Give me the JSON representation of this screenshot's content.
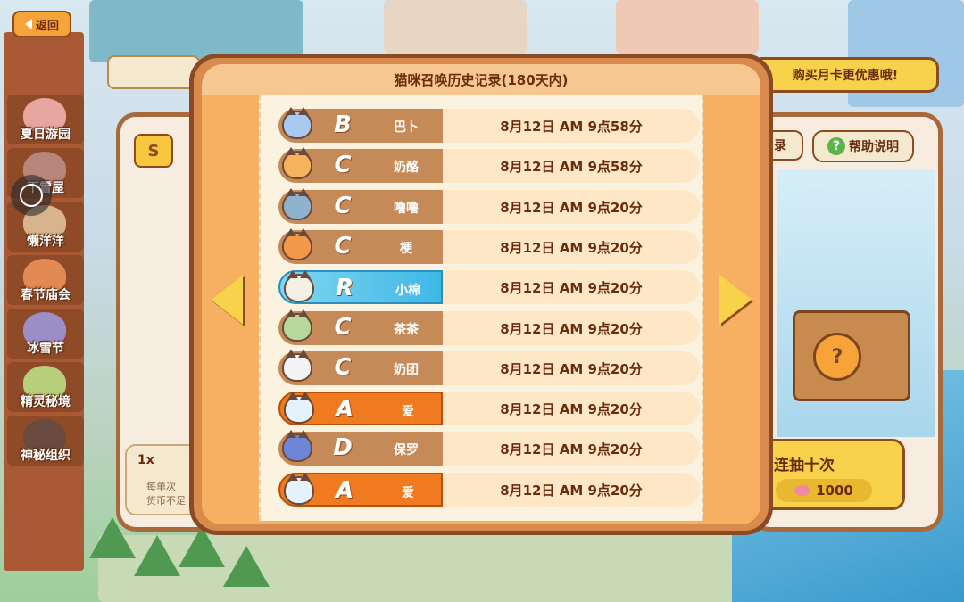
{
  "topbar": {
    "back_label": "返回"
  },
  "sidebar": {
    "events": [
      {
        "label": "夏日游园",
        "color": "#e7a7a0"
      },
      {
        "label": "下雪屋",
        "color": "#b8857a"
      },
      {
        "label": "懒洋洋",
        "color": "#d7b48d"
      },
      {
        "label": "春节庙会",
        "color": "#e28a52"
      },
      {
        "label": "冰雪节",
        "color": "#9b8ec9"
      },
      {
        "label": "精灵秘境",
        "color": "#b7cf7a"
      },
      {
        "label": "神秘组织",
        "color": "#6a4a3f"
      }
    ]
  },
  "background_ui": {
    "coin_symbol": "S",
    "promo_banner": "购买月卡更优惠哦!",
    "record_tab": "录",
    "help_label": "帮助说明",
    "ten_draw": {
      "title": "连抽十次",
      "cost": "1000"
    },
    "single_draw": {
      "qty": "1x",
      "note_line1": "每单次",
      "note_line2": "货币不足"
    }
  },
  "modal": {
    "title": "猫咪召唤历史记录(180天内)",
    "rows": [
      {
        "rank": "B",
        "name": "巴卜",
        "time": "8月12日 AM 9点58分",
        "cat_color": "#a9c9f0",
        "style": "normal"
      },
      {
        "rank": "C",
        "name": "奶酪",
        "time": "8月12日 AM 9点58分",
        "cat_color": "#f6b35c",
        "style": "normal"
      },
      {
        "rank": "C",
        "name": "噜噜",
        "time": "8月12日 AM 9点20分",
        "cat_color": "#8fb3cf",
        "style": "normal"
      },
      {
        "rank": "C",
        "name": "梗",
        "time": "8月12日 AM 9点20分",
        "cat_color": "#f39a4a",
        "style": "normal"
      },
      {
        "rank": "R",
        "name": "小棉",
        "time": "8月12日 AM 9点20分",
        "cat_color": "#f6efe6",
        "style": "r-rank"
      },
      {
        "rank": "C",
        "name": "茶茶",
        "time": "8月12日 AM 9点20分",
        "cat_color": "#b6d89a",
        "style": "normal"
      },
      {
        "rank": "C",
        "name": "奶团",
        "time": "8月12日 AM 9点20分",
        "cat_color": "#f3f3f3",
        "style": "normal"
      },
      {
        "rank": "A",
        "name": "爱",
        "time": "8月12日 AM 9点20分",
        "cat_color": "#e6f2fb",
        "style": "a-rank"
      },
      {
        "rank": "D",
        "name": "保罗",
        "time": "8月12日 AM 9点20分",
        "cat_color": "#6f86d8",
        "style": "normal"
      },
      {
        "rank": "A",
        "name": "爱",
        "time": "8月12日 AM 9点20分",
        "cat_color": "#e6f2fb",
        "style": "a-rank"
      }
    ]
  },
  "icons": {
    "back": "left-arrow-icon",
    "prev": "prev-page-arrow-icon",
    "next": "next-page-arrow-icon",
    "help": "question-mark-icon"
  }
}
